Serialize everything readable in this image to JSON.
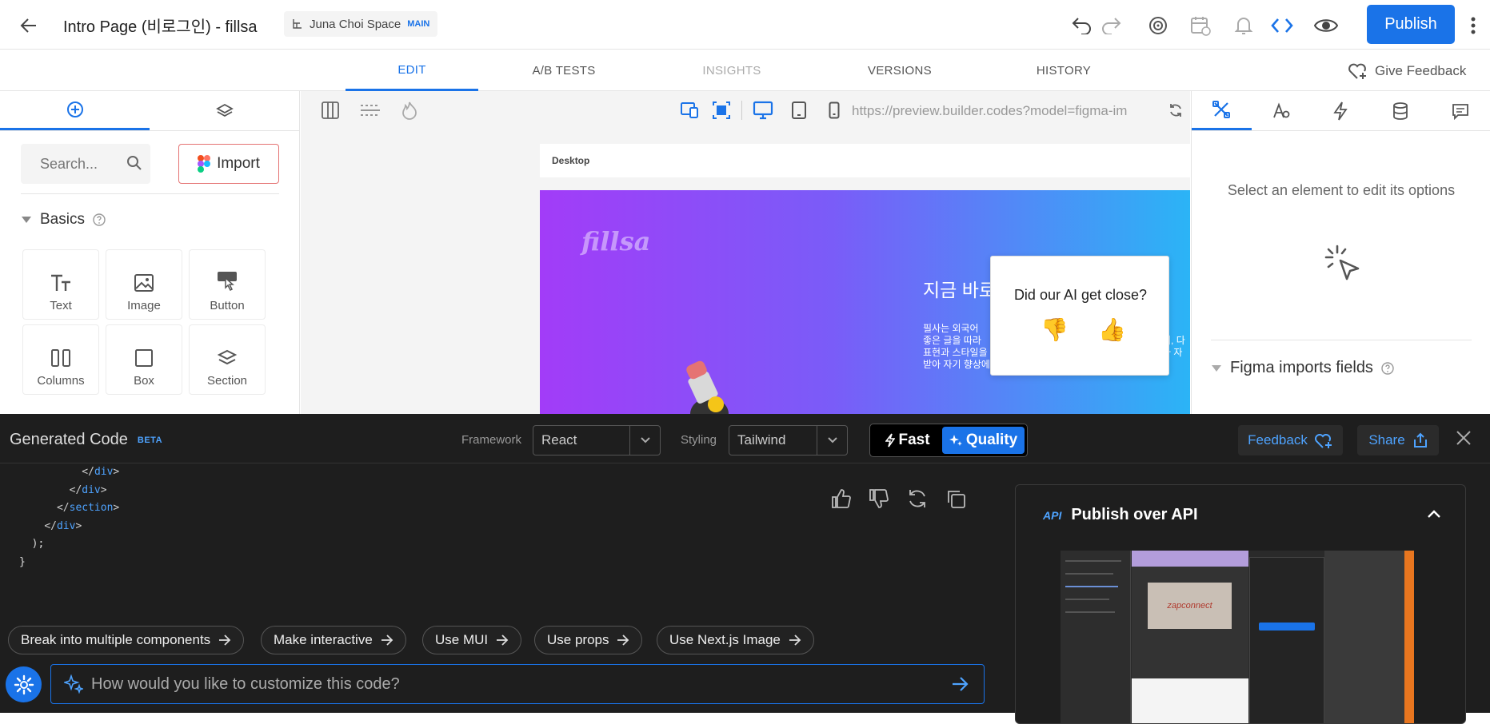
{
  "header": {
    "title": "Intro Page (비로그인) - fillsa",
    "space_name": "Juna Choi Space",
    "space_badge": "MAIN",
    "publish_label": "Publish"
  },
  "tabs": [
    {
      "label": "EDIT",
      "state": "active"
    },
    {
      "label": "A/B TESTS",
      "state": "normal"
    },
    {
      "label": "INSIGHTS",
      "state": "disabled"
    },
    {
      "label": "VERSIONS",
      "state": "normal"
    },
    {
      "label": "HISTORY",
      "state": "normal"
    }
  ],
  "give_feedback_label": "Give Feedback",
  "left_panel": {
    "search_placeholder": "Search...",
    "import_label": "Import",
    "section_title": "Basics",
    "blocks": [
      {
        "label": "Text",
        "icon": "text-icon"
      },
      {
        "label": "Image",
        "icon": "image-icon"
      },
      {
        "label": "Button",
        "icon": "button-icon"
      },
      {
        "label": "Columns",
        "icon": "columns-icon"
      },
      {
        "label": "Box",
        "icon": "box-icon"
      },
      {
        "label": "Section",
        "icon": "section-icon"
      }
    ]
  },
  "canvas": {
    "url": "https://preview.builder.codes?model=figma-im",
    "frame_label": "Desktop",
    "hero_logo": "fillsa",
    "hero_heading": "지금 바로",
    "hero_text_lines": [
      "필사는 외국어",
      "좋은 글을 따라",
      "표현과 스타일을",
      "받아 자기 향상에 도움이 됩니다."
    ],
    "hero_text_right": [
      "며, 다",
      "와 자"
    ],
    "ai_popup_question": "Did our AI get close?",
    "thumbs_down": "👎",
    "thumbs_up": "👍"
  },
  "right_panel": {
    "message": "Select an element to edit its options",
    "figma_fields_label": "Figma imports fields"
  },
  "code_panel": {
    "title": "Generated Code",
    "beta": "BETA",
    "framework_label": "Framework",
    "framework_value": "React",
    "styling_label": "Styling",
    "styling_value": "Tailwind",
    "mode_fast": "Fast",
    "mode_quality": "Quality",
    "feedback_label": "Feedback",
    "share_label": "Share",
    "code_lines": [
      {
        "indent": 10,
        "tag": "</div>"
      },
      {
        "indent": 8,
        "tag": "</div>"
      },
      {
        "indent": 6,
        "tag": "</section>"
      },
      {
        "indent": 4,
        "tag": "</div>"
      },
      {
        "indent": 2,
        "plain": ");"
      },
      {
        "indent": 0,
        "plain": "}"
      }
    ],
    "chips": [
      "Break into multiple components",
      "Make interactive",
      "Use MUI",
      "Use props",
      "Use Next.js Image"
    ],
    "prompt_placeholder": "How would you like to customize this code?",
    "api_badge": "API",
    "api_title": "Publish over API",
    "api_preview_logo": "zapconnect"
  },
  "colors": {
    "accent": "#1a73e8",
    "code_bg": "#1e1e1e",
    "hero_gradient_start": "#a23cf8",
    "hero_gradient_end": "#2bb4f6"
  }
}
